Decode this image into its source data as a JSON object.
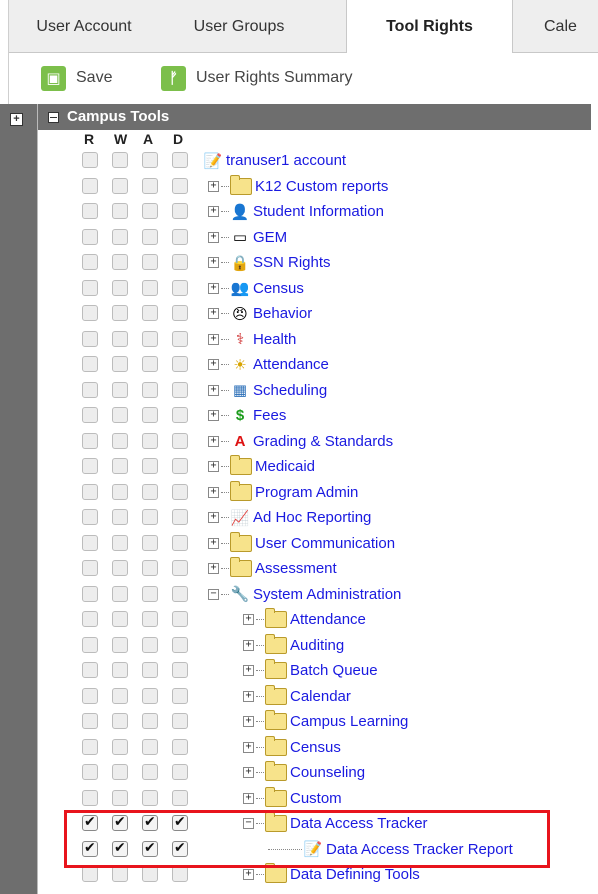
{
  "tabs": [
    "User Account",
    "User Groups",
    "Tool Rights",
    "Cale"
  ],
  "active_tab": "Tool Rights",
  "toolbar": {
    "save_label": "Save",
    "summary_label": "User Rights Summary"
  },
  "panel": {
    "title": "Campus Tools",
    "rights_headers": [
      "R",
      "W",
      "A",
      "D"
    ]
  },
  "tree": [
    {
      "label": "tranuser1 account",
      "level": 0,
      "icon": "account-icon",
      "checked": false,
      "toggle": ""
    },
    {
      "label": "K12 Custom reports",
      "level": 1,
      "icon": "folder-icon",
      "checked": false,
      "toggle": "+"
    },
    {
      "label": "Student Information",
      "level": 1,
      "icon": "student-icon",
      "checked": false,
      "toggle": "+"
    },
    {
      "label": "GEM",
      "level": 1,
      "icon": "gem-icon",
      "checked": false,
      "toggle": "+"
    },
    {
      "label": "SSN Rights",
      "level": 1,
      "icon": "lock-icon",
      "checked": false,
      "toggle": "+"
    },
    {
      "label": "Census",
      "level": 1,
      "icon": "census-icon",
      "checked": false,
      "toggle": "+"
    },
    {
      "label": "Behavior",
      "level": 1,
      "icon": "behavior-icon",
      "checked": false,
      "toggle": "+"
    },
    {
      "label": "Health",
      "level": 1,
      "icon": "health-icon",
      "checked": false,
      "toggle": "+"
    },
    {
      "label": "Attendance",
      "level": 1,
      "icon": "attendance-icon",
      "checked": false,
      "toggle": "+"
    },
    {
      "label": "Scheduling",
      "level": 1,
      "icon": "scheduling-icon",
      "checked": false,
      "toggle": "+"
    },
    {
      "label": "Fees",
      "level": 1,
      "icon": "dollar-icon",
      "checked": false,
      "toggle": "+"
    },
    {
      "label": "Grading & Standards",
      "level": 1,
      "icon": "grading-icon",
      "checked": false,
      "toggle": "+"
    },
    {
      "label": "Medicaid",
      "level": 1,
      "icon": "folder-icon",
      "checked": false,
      "toggle": "+"
    },
    {
      "label": "Program Admin",
      "level": 1,
      "icon": "folder-icon",
      "checked": false,
      "toggle": "+"
    },
    {
      "label": "Ad Hoc Reporting",
      "level": 1,
      "icon": "chart-icon",
      "checked": false,
      "toggle": "+"
    },
    {
      "label": "User Communication",
      "level": 1,
      "icon": "folder-icon",
      "checked": false,
      "toggle": "+"
    },
    {
      "label": "Assessment",
      "level": 1,
      "icon": "folder-icon",
      "checked": false,
      "toggle": "+"
    },
    {
      "label": "System Administration",
      "level": 1,
      "icon": "tools-icon",
      "checked": false,
      "toggle": "-"
    },
    {
      "label": "Attendance",
      "level": 2,
      "icon": "folder-icon",
      "checked": false,
      "toggle": "+"
    },
    {
      "label": "Auditing",
      "level": 2,
      "icon": "folder-icon",
      "checked": false,
      "toggle": "+"
    },
    {
      "label": "Batch Queue",
      "level": 2,
      "icon": "folder-icon",
      "checked": false,
      "toggle": "+"
    },
    {
      "label": "Calendar",
      "level": 2,
      "icon": "folder-icon",
      "checked": false,
      "toggle": "+"
    },
    {
      "label": "Campus Learning",
      "level": 2,
      "icon": "folder-icon",
      "checked": false,
      "toggle": "+"
    },
    {
      "label": "Census",
      "level": 2,
      "icon": "folder-icon",
      "checked": false,
      "toggle": "+"
    },
    {
      "label": "Counseling",
      "level": 2,
      "icon": "folder-icon",
      "checked": false,
      "toggle": "+"
    },
    {
      "label": "Custom",
      "level": 2,
      "icon": "folder-icon",
      "checked": false,
      "toggle": "+"
    },
    {
      "label": "Data Access Tracker",
      "level": 2,
      "icon": "folder-icon",
      "checked": true,
      "toggle": "-"
    },
    {
      "label": "Data Access Tracker Report",
      "level": 3,
      "icon": "report-icon",
      "checked": true,
      "toggle": ""
    },
    {
      "label": "Data Defining Tools",
      "level": 2,
      "icon": "folder-icon",
      "checked": false,
      "toggle": "+"
    }
  ]
}
